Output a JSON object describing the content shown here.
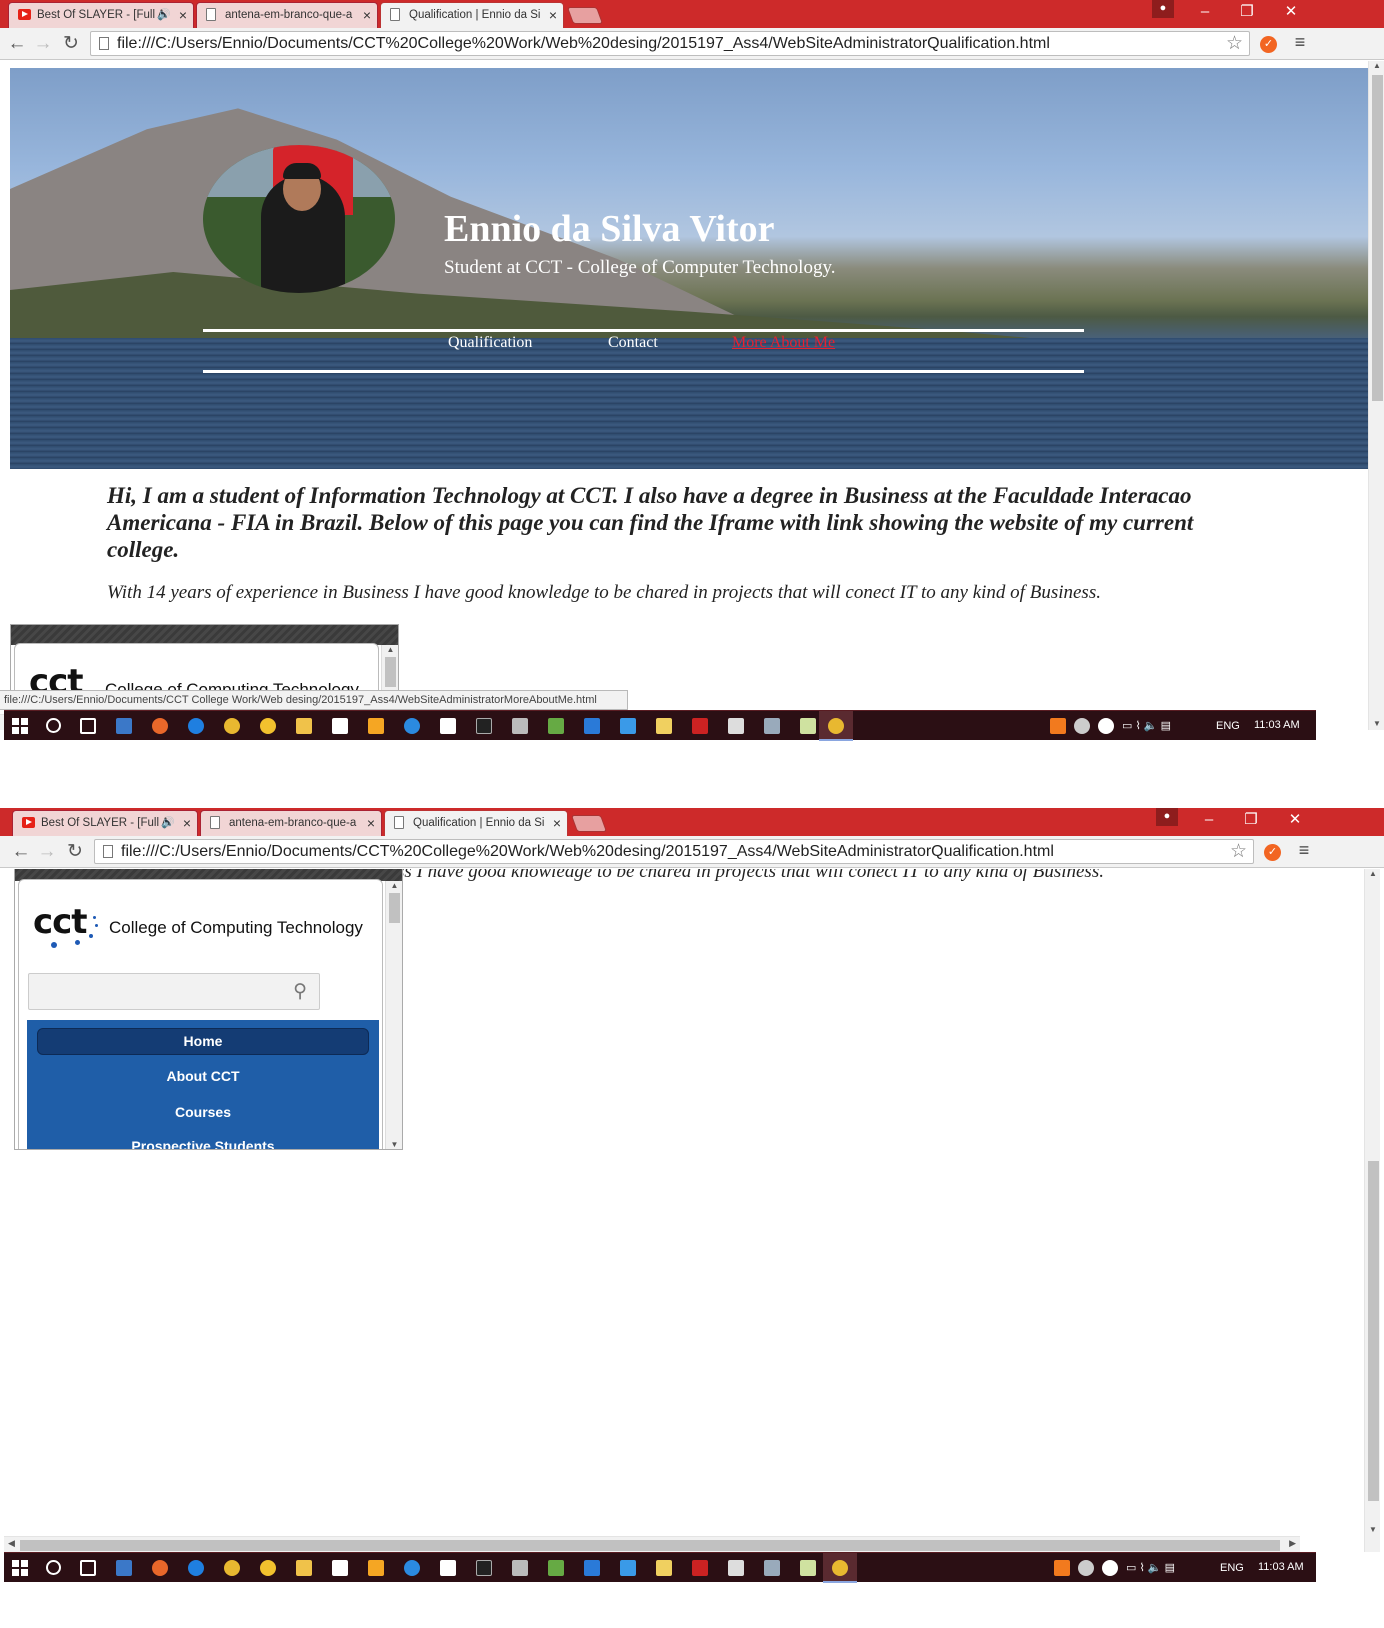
{
  "browser": {
    "tabs": [
      {
        "label": "Best Of SLAYER - [Full A",
        "icon": "youtube-icon"
      },
      {
        "label": "antena-em-branco-que-a",
        "icon": "page-icon"
      },
      {
        "label": "Qualification | Ennio da Si",
        "icon": "page-icon"
      }
    ],
    "url": "file:///C:/Users/Ennio/Documents/CCT%20College%20Work/Web%20desing/2015197_Ass4/WebSiteAdministratorQualification.html",
    "status_url": "file:///C:/Users/Ennio/Documents/CCT College Work/Web desing/2015197_Ass4/WebSiteAdministratorMoreAboutMe.html",
    "accent_color": "#cd2a2a"
  },
  "page": {
    "name": "Ennio da Silva Vitor",
    "subtitle": "Student at CCT - College of Computer Technology.",
    "nav": [
      {
        "label": "Qualification"
      },
      {
        "label": "Contact"
      },
      {
        "label": "More About Me"
      }
    ],
    "intro_bold": "Hi, I am a student of Information Technology at CCT. I also have a degree in Business at the Faculdade Interacao Americana - FIA in Brazil. Below of this page you can find the Iframe with link showing the website of my current college.",
    "intro_text": "With 14 years of experience in Business I have good knowledge to be chared in projects that will conect IT to any kind of Business."
  },
  "iframe": {
    "logo": "cct",
    "title": "College of Computing Technology",
    "menu": [
      "Home",
      "About CCT",
      "Courses",
      "Prospective Students"
    ]
  },
  "taskbar": {
    "language": "ENG",
    "time": "11:03 AM"
  }
}
